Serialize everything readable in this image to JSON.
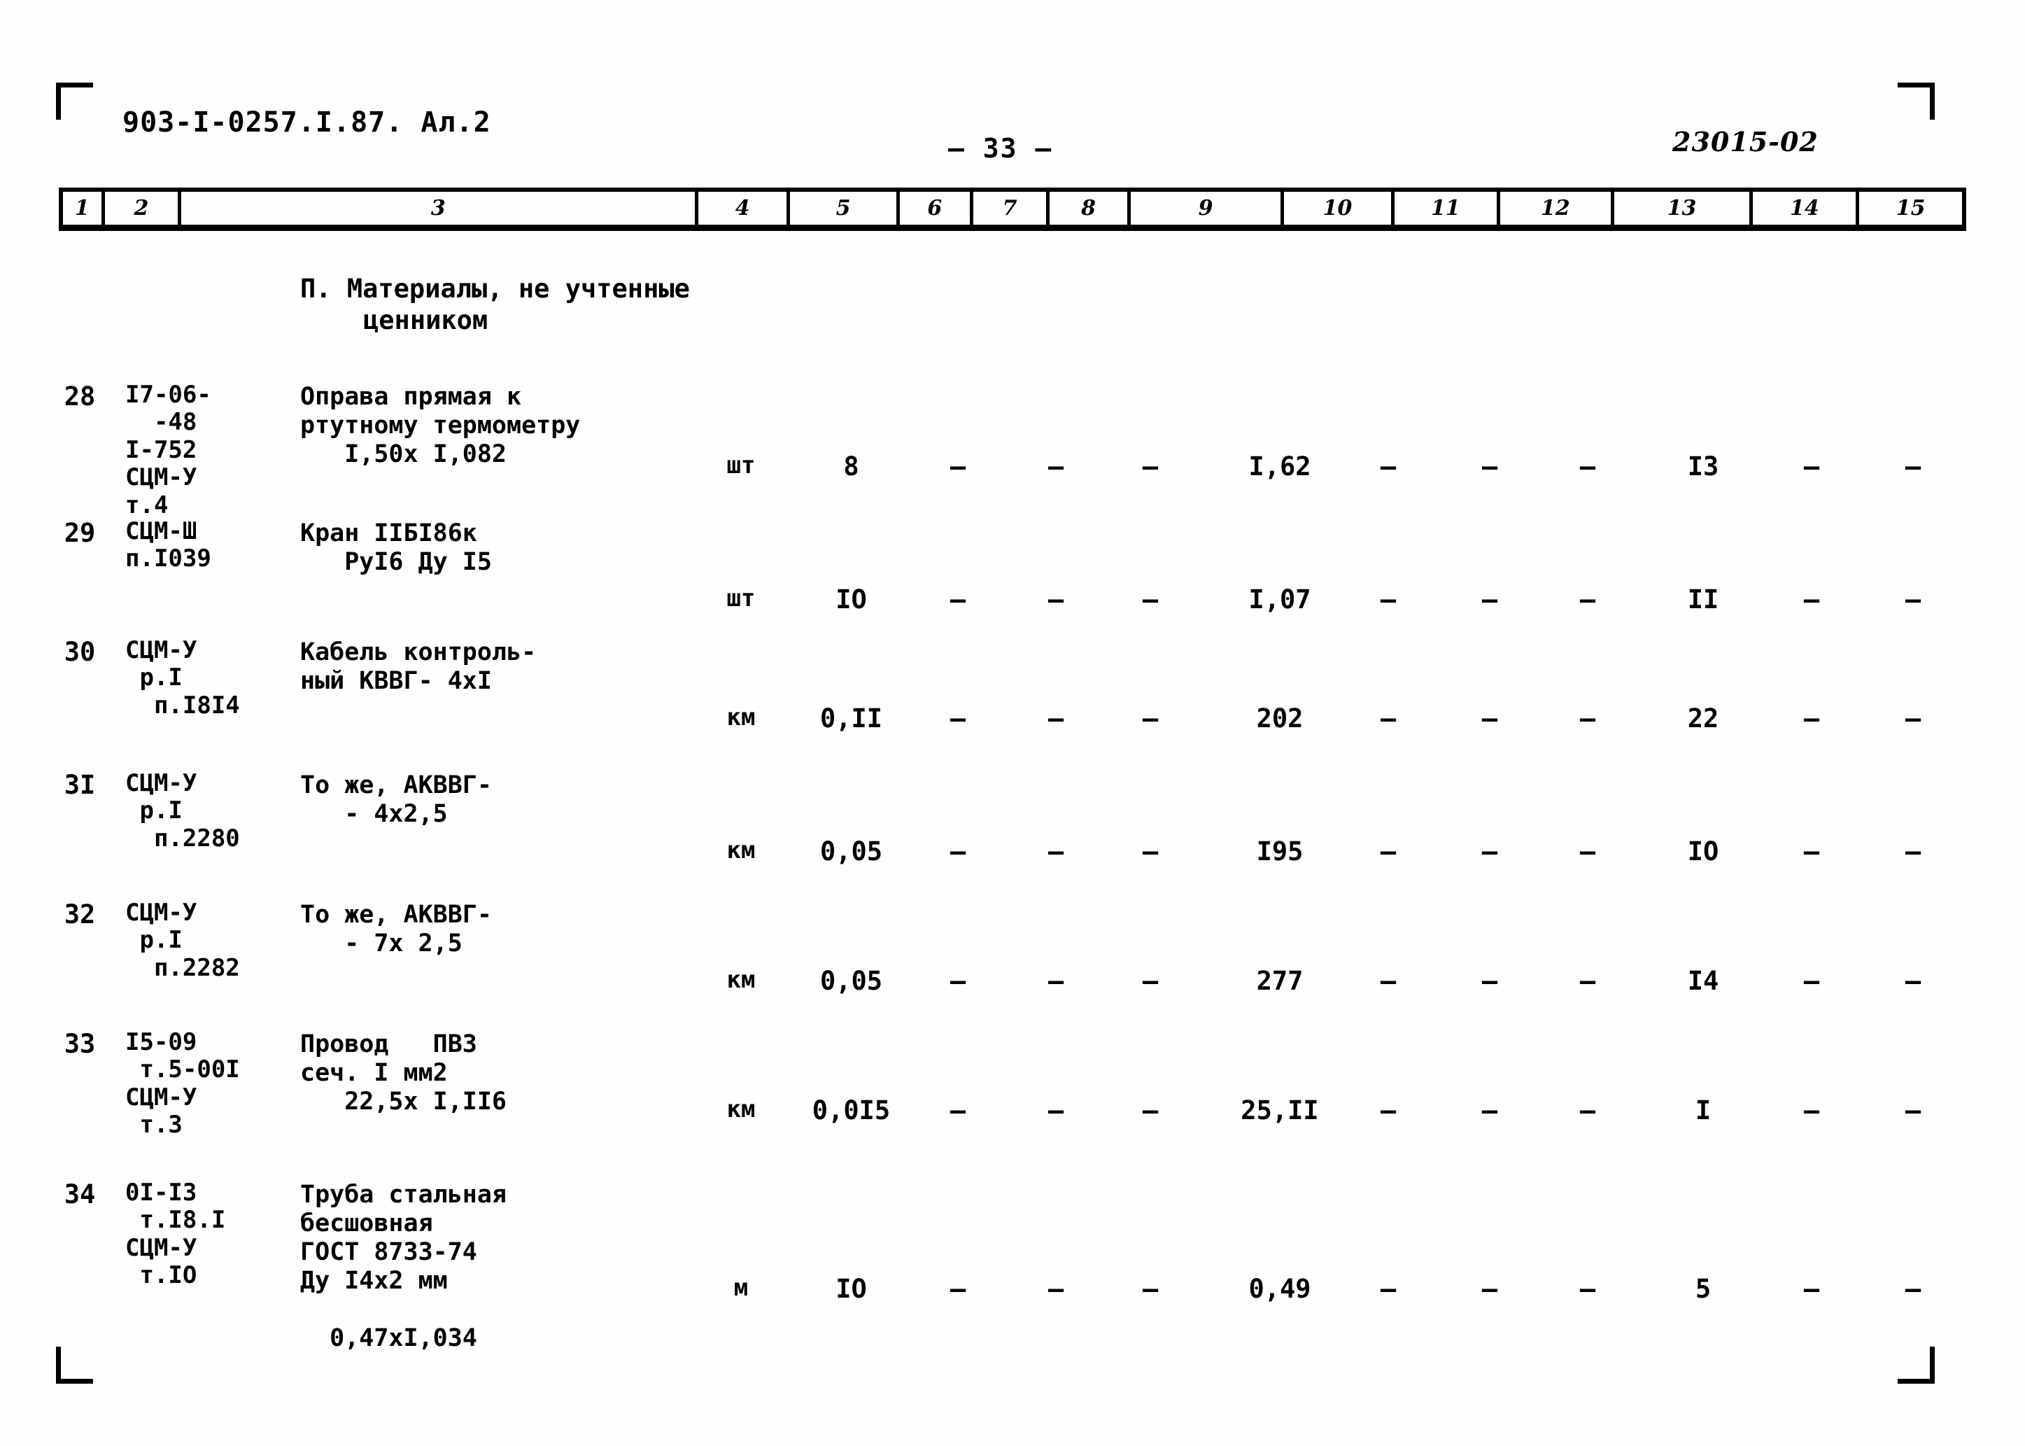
{
  "header": {
    "doc_code": "903-I-0257.I.87. Ал.2",
    "page_number": "— 33 —",
    "archive_code": "23015-02"
  },
  "table": {
    "column_numbers": [
      "1",
      "2",
      "3",
      "4",
      "5",
      "6",
      "7",
      "8",
      "9",
      "10",
      "11",
      "12",
      "13",
      "14",
      "15"
    ],
    "section_title_line1": "П. Материалы, не учтенные",
    "section_title_line2": "ценником",
    "rows": [
      {
        "num": "28",
        "code": "I7-06-\n  -48\nI-752\nСЦМ-У\nт.4",
        "name": "Оправа прямая к\nртутному термометру\n   I,50х I,082",
        "unit": "шт",
        "qty": "8",
        "c6": "—",
        "c7": "—",
        "c8": "—",
        "c9": "I,62",
        "c10": "—",
        "c11": "—",
        "c12": "—",
        "c13": "I3",
        "c14": "—",
        "c15": "—"
      },
      {
        "num": "29",
        "code": "СЦМ-Ш\nп.I039",
        "name": "Кран IIБI86к\n   РуI6 Ду I5",
        "unit": "шт",
        "qty": "IO",
        "c6": "—",
        "c7": "—",
        "c8": "—",
        "c9": "I,07",
        "c10": "—",
        "c11": "—",
        "c12": "—",
        "c13": "II",
        "c14": "—",
        "c15": "—"
      },
      {
        "num": "30",
        "code": "СЦМ-У\n р.I\n  п.I8I4",
        "name": "Кабель контроль-\nный КВВГ- 4хI",
        "unit": "км",
        "qty": "0,II",
        "c6": "—",
        "c7": "—",
        "c8": "—",
        "c9": "202",
        "c10": "—",
        "c11": "—",
        "c12": "—",
        "c13": "22",
        "c14": "—",
        "c15": "—"
      },
      {
        "num": "3I",
        "code": "СЦМ-У\n р.I\n  п.2280",
        "name": "То же, АКВВГ-\n   - 4х2,5",
        "unit": "км",
        "qty": "0,05",
        "c6": "—",
        "c7": "—",
        "c8": "—",
        "c9": "I95",
        "c10": "—",
        "c11": "—",
        "c12": "—",
        "c13": "IO",
        "c14": "—",
        "c15": "—"
      },
      {
        "num": "32",
        "code": "СЦМ-У\n р.I\n  п.2282",
        "name": "То же, АКВВГ-\n   - 7х 2,5",
        "unit": "км",
        "qty": "0,05",
        "c6": "—",
        "c7": "—",
        "c8": "—",
        "c9": "277",
        "c10": "—",
        "c11": "—",
        "c12": "—",
        "c13": "I4",
        "c14": "—",
        "c15": "—"
      },
      {
        "num": "33",
        "code": "I5-09\n т.5-00I\nСЦМ-У\n т.3",
        "name": "Провод   ПВЗ\nсеч. I мм2\n   22,5х I,II6",
        "unit": "км",
        "qty": "0,0I5",
        "c6": "—",
        "c7": "—",
        "c8": "—",
        "c9": "25,II",
        "c10": "—",
        "c11": "—",
        "c12": "—",
        "c13": "I",
        "c14": "—",
        "c15": "—"
      },
      {
        "num": "34",
        "code": "0I-I3\n т.I8.I\nСЦМ-У\n т.IO",
        "name": "Труба стальная\nбесшовная\nГОСТ 8733-74\nДу I4х2 мм\n\n  0,47хI,034",
        "unit": "м",
        "qty": "IO",
        "c6": "—",
        "c7": "—",
        "c8": "—",
        "c9": "0,49",
        "c10": "—",
        "c11": "—",
        "c12": "—",
        "c13": "5",
        "c14": "—",
        "c15": "—"
      }
    ]
  }
}
